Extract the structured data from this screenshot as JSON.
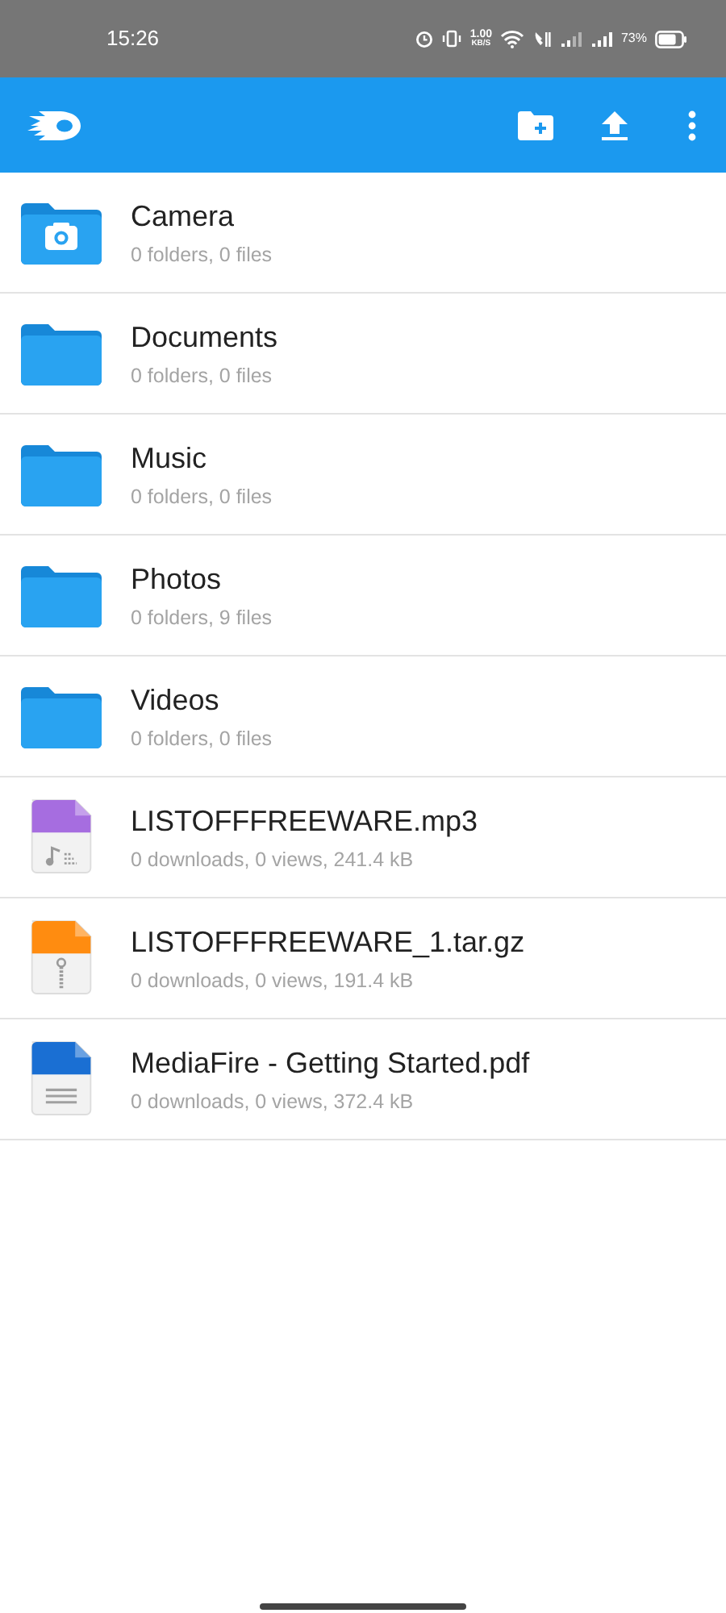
{
  "status_bar": {
    "time": "15:26",
    "net_speed": "1.00",
    "net_unit": "KB/S",
    "battery": "73%"
  },
  "items": [
    {
      "kind": "camera-folder",
      "name": "Camera",
      "details": "0 folders, 0 files"
    },
    {
      "kind": "folder",
      "name": "Documents",
      "details": "0 folders, 0 files"
    },
    {
      "kind": "folder",
      "name": "Music",
      "details": "0 folders, 0 files"
    },
    {
      "kind": "folder",
      "name": "Photos",
      "details": "0 folders, 9 files"
    },
    {
      "kind": "folder",
      "name": "Videos",
      "details": "0 folders, 0 files"
    },
    {
      "kind": "audio",
      "name": "LISTOFFFREEWARE.mp3",
      "details": "0 downloads, 0 views, 241.4 kB"
    },
    {
      "kind": "archive",
      "name": "LISTOFFFREEWARE_1.tar.gz",
      "details": "0 downloads, 0 views, 191.4 kB"
    },
    {
      "kind": "document",
      "name": "MediaFire - Getting Started.pdf",
      "details": "0 downloads, 0 views, 372.4 kB"
    }
  ]
}
